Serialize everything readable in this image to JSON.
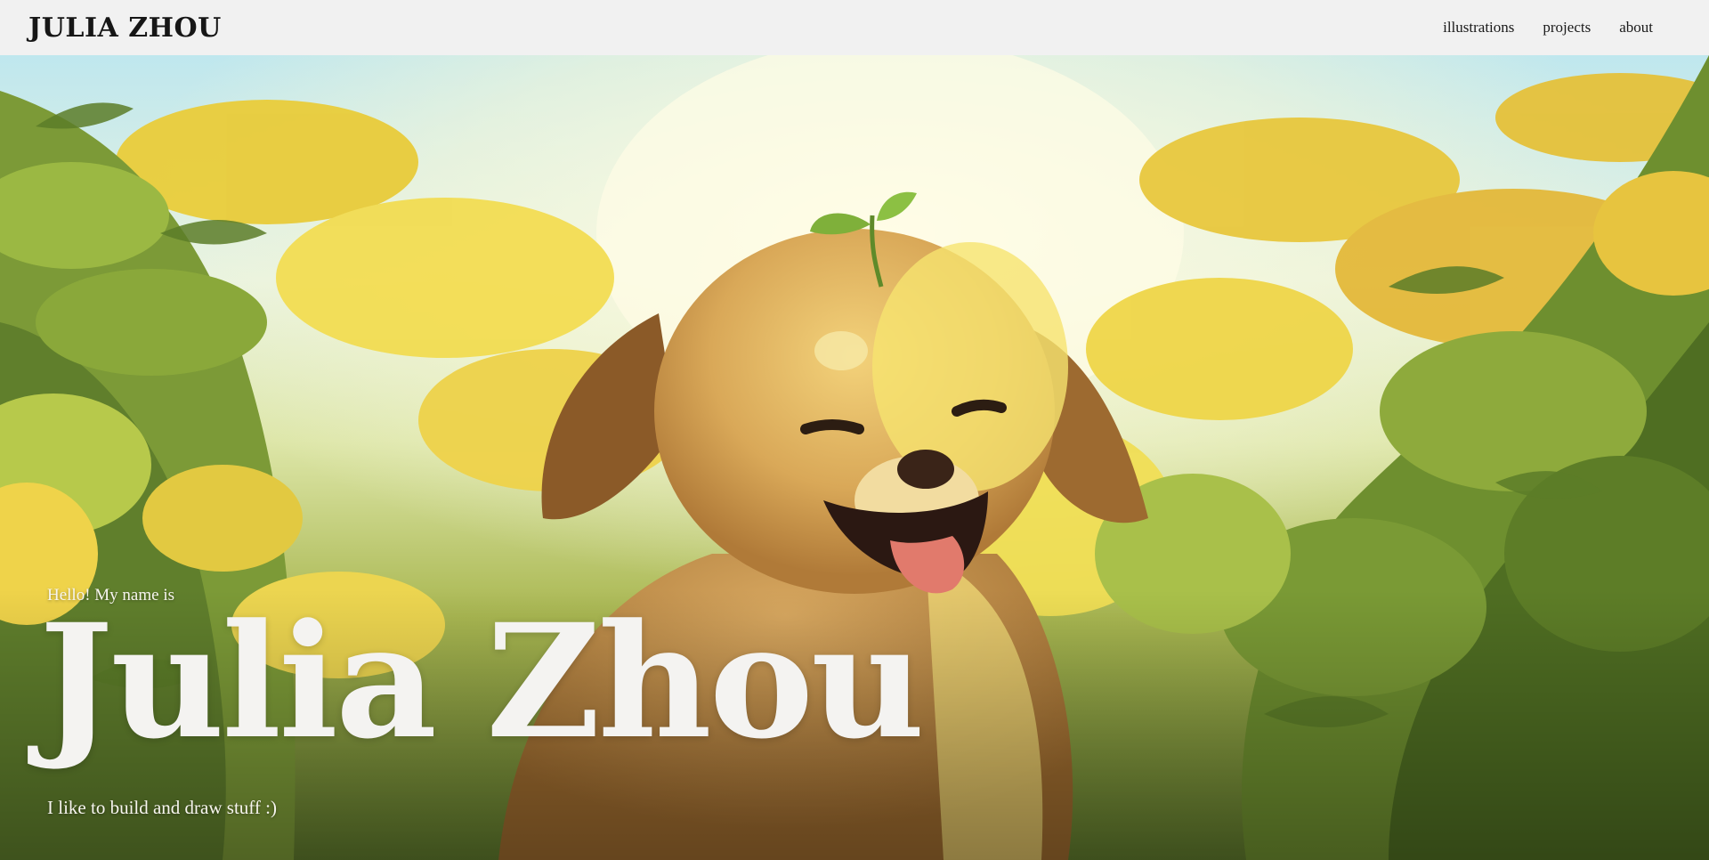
{
  "header": {
    "logo": "JULIA ZHOU",
    "nav": [
      {
        "label": "illustrations"
      },
      {
        "label": "projects"
      },
      {
        "label": "about"
      }
    ]
  },
  "hero": {
    "greeting": "Hello! My name is",
    "name": "Julia Zhou",
    "tagline": "I like to build and draw stuff :)",
    "illustration": "smiling golden puppy with a sprout on its head in a field of yellow goldenrod flowers"
  },
  "colors": {
    "header_bg": "#f1f1f1",
    "header_text": "#161616",
    "hero_text": "#f4f3f1"
  }
}
